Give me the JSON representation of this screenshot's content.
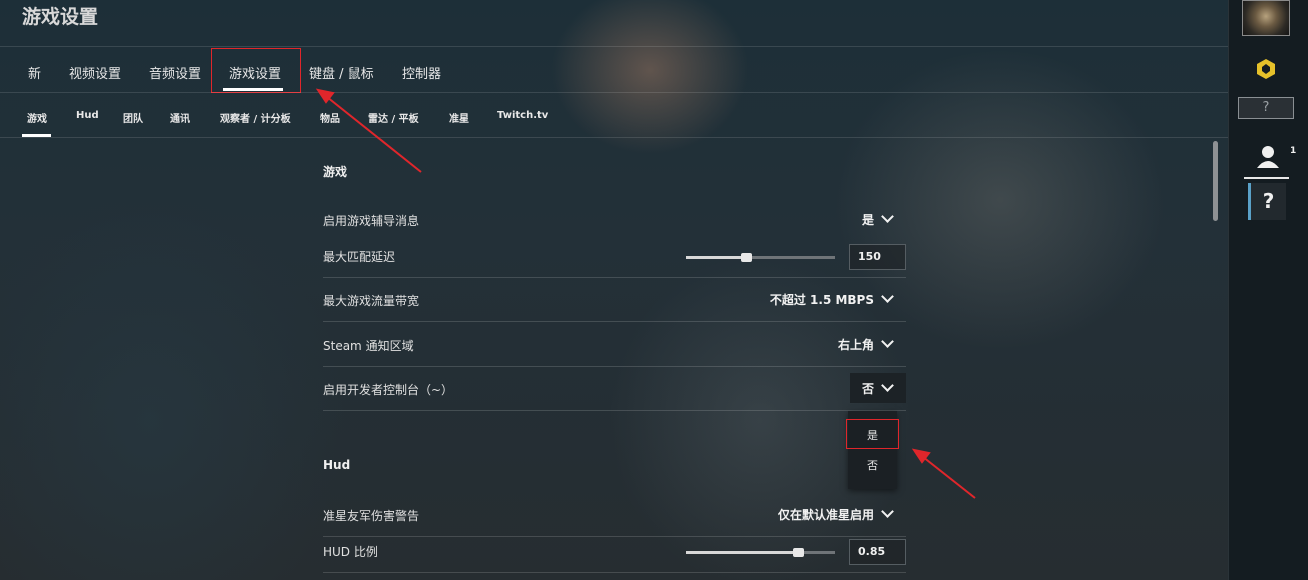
{
  "window": {
    "title": "游戏设置"
  },
  "main_tabs": [
    {
      "label": "新"
    },
    {
      "label": "视频设置"
    },
    {
      "label": "音频设置"
    },
    {
      "label": "游戏设置"
    },
    {
      "label": "键盘 / 鼠标"
    },
    {
      "label": "控制器"
    }
  ],
  "main_tab_active": "游戏设置",
  "sub_tabs": [
    {
      "label": "游戏"
    },
    {
      "label": "Hud"
    },
    {
      "label": "团队"
    },
    {
      "label": "通讯"
    },
    {
      "label": "观察者 / 计分板"
    },
    {
      "label": "物品"
    },
    {
      "label": "雷达 / 平板"
    },
    {
      "label": "准星"
    },
    {
      "label": "Twitch.tv"
    }
  ],
  "sub_tab_active": "游戏",
  "sections": {
    "game": {
      "heading": "游戏",
      "rows": {
        "tutor": {
          "label": "启用游戏辅导消息",
          "value": "是"
        },
        "max_ping": {
          "label": "最大匹配延迟",
          "value": "150",
          "slider_fraction": 0.4
        },
        "bandwidth": {
          "label": "最大游戏流量带宽",
          "value": "不超过 1.5 MBPS"
        },
        "steam_notify": {
          "label": "Steam 通知区域",
          "value": "右上角"
        },
        "dev_console": {
          "label": "启用开发者控制台（~）",
          "value": "否"
        }
      }
    },
    "hud": {
      "heading": "Hud",
      "rows": {
        "ff_warning": {
          "label": "准星友军伤害警告",
          "value": "仅在默认准星启用"
        },
        "hud_scale": {
          "label": "HUD 比例",
          "value": "0.85",
          "slider_fraction": 0.75
        }
      }
    }
  },
  "dropdown_menu": {
    "options": [
      "是",
      "否"
    ],
    "highlighted": "是"
  },
  "right_bar": {
    "help_label": "?",
    "friends_count": "1"
  },
  "colors": {
    "annotation_red": "#e0262b",
    "accent_blue": "#5aa1c8"
  }
}
